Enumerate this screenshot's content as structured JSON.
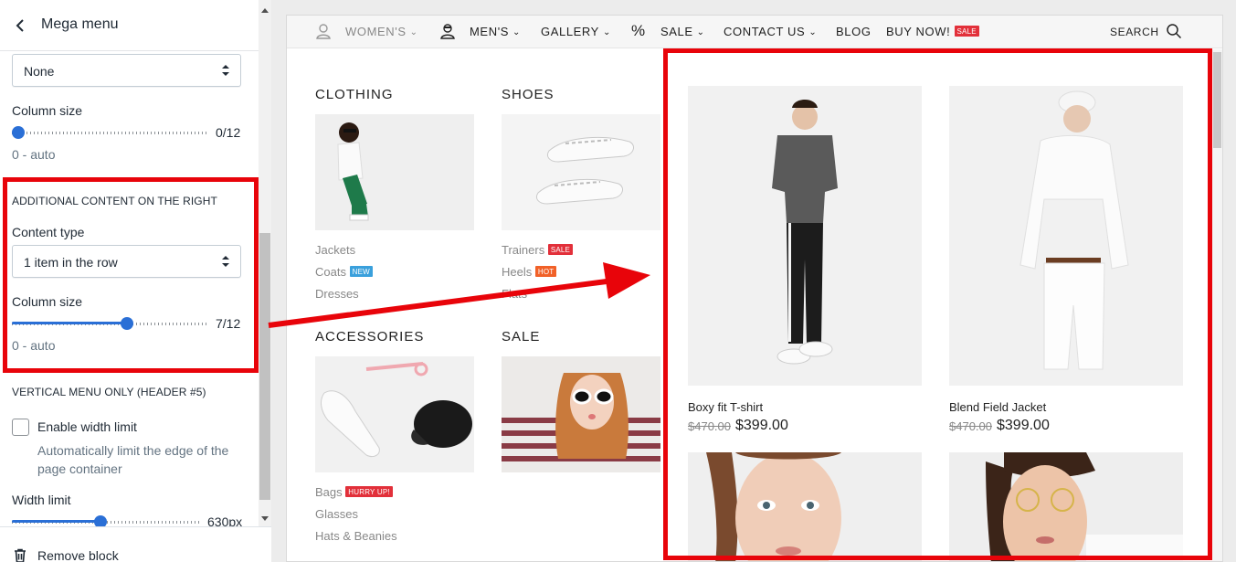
{
  "panel": {
    "title": "Mega menu",
    "top_select": {
      "value": "None"
    },
    "column_size": {
      "label": "Column size",
      "value_text": "0/12",
      "value": 0,
      "max": 12,
      "hint": "0 - auto"
    },
    "additional": {
      "title": "ADDITIONAL CONTENT ON THE RIGHT",
      "content_type_label": "Content type",
      "content_type_value": "1 item in the row",
      "column_size_label": "Column size",
      "column_size_value_text": "7/12",
      "column_size_value": 7,
      "column_size_max": 12,
      "hint": "0 - auto"
    },
    "vertical": {
      "title": "VERTICAL MENU ONLY (HEADER #5)",
      "checkbox_label": "Enable width limit",
      "checkbox_checked": false,
      "checkbox_hint": "Automatically limit the edge of the page container",
      "width_label": "Width limit",
      "width_value_text": "630px",
      "width_fraction": 0.47
    },
    "remove_label": "Remove block"
  },
  "nav": {
    "items": [
      {
        "label": "WOMEN'S",
        "icon": "woman-avatar-icon",
        "dropdown": true,
        "muted": true
      },
      {
        "label": "MEN'S",
        "icon": "man-avatar-icon",
        "dropdown": true
      },
      {
        "label": "GALLERY",
        "dropdown": true
      },
      {
        "label": "SALE",
        "icon": "percent-icon",
        "dropdown": true
      },
      {
        "label": "CONTACT US",
        "dropdown": true
      },
      {
        "label": "BLOG"
      },
      {
        "label": "BUY NOW!",
        "badge": "SALE"
      }
    ],
    "search_label": "SEARCH"
  },
  "mega": {
    "categories": [
      {
        "title": "CLOTHING",
        "image": "woman-in-white-jacket-photo",
        "links": [
          {
            "label": "Jackets"
          },
          {
            "label": "Coats",
            "badge": "NEW"
          },
          {
            "label": "Dresses"
          }
        ]
      },
      {
        "title": "SHOES",
        "image": "white-sneakers-photo",
        "links": [
          {
            "label": "Trainers",
            "badge": "SALE"
          },
          {
            "label": "Heels",
            "badge": "HOT"
          },
          {
            "label": "Flats"
          }
        ]
      },
      {
        "title": "ACCESSORIES",
        "image": "sneaker-sunglasses-cap-photo",
        "links": [
          {
            "label": "Bags",
            "badge": "HURRY UP!"
          },
          {
            "label": "Glasses"
          },
          {
            "label": "Hats & Beanies"
          }
        ]
      },
      {
        "title": "SALE",
        "image": "woman-with-sunglasses-photo",
        "links": []
      }
    ],
    "products": [
      {
        "name": "Boxy fit T-shirt",
        "old_price": "$470.00",
        "price": "$399.00",
        "image": "man-grey-tshirt-photo"
      },
      {
        "name": "Blend Field Jacket",
        "old_price": "$470.00",
        "price": "$399.00",
        "image": "man-white-outfit-photo"
      },
      {
        "name": "",
        "image": "woman-braids-portrait-photo"
      },
      {
        "name": "",
        "image": "woman-glasses-portrait-photo"
      }
    ]
  },
  "colors": {
    "highlight": "#e8040a",
    "slider_accent": "#2a6fd6",
    "badge_sale": "#e2303a",
    "badge_new": "#3aa0dc",
    "badge_hot": "#f16128"
  }
}
